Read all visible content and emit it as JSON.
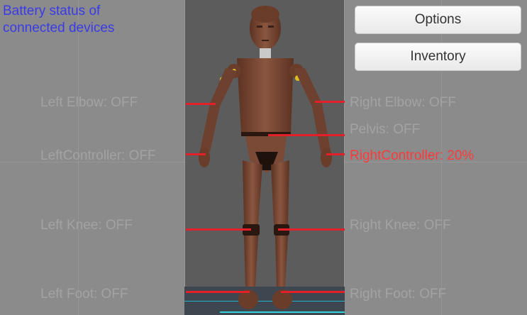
{
  "title": "Battery status of connected devices",
  "buttons": {
    "options": "Options",
    "inventory": "Inventory"
  },
  "sensors": {
    "left_elbow": "Left Elbow: OFF",
    "right_elbow": "Right Elbow: OFF",
    "pelvis": "Pelvis: OFF",
    "left_controller": "LeftController: OFF",
    "right_controller": "RightController: 20%",
    "left_knee": "Left Knee: OFF",
    "right_knee": "Right Knee: OFF",
    "left_foot": "Left Foot: OFF",
    "right_foot": "Right Foot: OFF"
  },
  "colors": {
    "title": "#3a3ae8",
    "inactive_label": "#a3a3a3",
    "active_label": "#ff3a3a",
    "leader_line": "#e3202a",
    "mannequin": "#7a4a36"
  }
}
